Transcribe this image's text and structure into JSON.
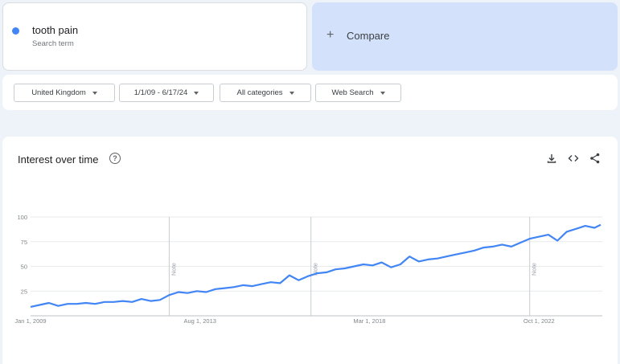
{
  "search_term": {
    "label": "tooth pain",
    "sublabel": "Search term",
    "color": "#4285f4"
  },
  "compare": {
    "icon": "plus-icon",
    "label": "Compare"
  },
  "filters": [
    {
      "label": "United Kingdom"
    },
    {
      "label": "1/1/09 - 6/17/24"
    },
    {
      "label": "All categories"
    },
    {
      "label": "Web Search"
    }
  ],
  "chart_section": {
    "title": "Interest over time",
    "help_icon": "help-circle-icon",
    "actions": [
      "download-icon",
      "embed-code-icon",
      "share-icon"
    ]
  },
  "chart_data": {
    "type": "line",
    "y_ticks": [
      "100",
      "75",
      "50",
      "25"
    ],
    "ylim": [
      0,
      100
    ],
    "x_ticks": [
      "Jan 1, 2009",
      "Aug 1, 2013",
      "Mar 1, 2018",
      "Oct 1, 2022"
    ],
    "notes": [
      "Note",
      "Note",
      "Note"
    ],
    "series": [
      {
        "color": "#4285f4",
        "points": [
          [
            "2009-01",
            9
          ],
          [
            "2009-04",
            11
          ],
          [
            "2009-07",
            13
          ],
          [
            "2009-10",
            10
          ],
          [
            "2010-01",
            12
          ],
          [
            "2010-04",
            12
          ],
          [
            "2010-07",
            13
          ],
          [
            "2010-10",
            12
          ],
          [
            "2011-01",
            14
          ],
          [
            "2011-04",
            14
          ],
          [
            "2011-07",
            15
          ],
          [
            "2011-10",
            14
          ],
          [
            "2012-01",
            17
          ],
          [
            "2012-04",
            15
          ],
          [
            "2012-07",
            16
          ],
          [
            "2012-10",
            21
          ],
          [
            "2013-01",
            24
          ],
          [
            "2013-04",
            23
          ],
          [
            "2013-07",
            25
          ],
          [
            "2013-10",
            24
          ],
          [
            "2014-01",
            27
          ],
          [
            "2014-04",
            28
          ],
          [
            "2014-07",
            29
          ],
          [
            "2014-10",
            31
          ],
          [
            "2015-01",
            30
          ],
          [
            "2015-04",
            32
          ],
          [
            "2015-07",
            34
          ],
          [
            "2015-10",
            33
          ],
          [
            "2016-01",
            41
          ],
          [
            "2016-04",
            36
          ],
          [
            "2016-07",
            40
          ],
          [
            "2016-10",
            43
          ],
          [
            "2017-01",
            44
          ],
          [
            "2017-04",
            47
          ],
          [
            "2017-07",
            48
          ],
          [
            "2017-10",
            50
          ],
          [
            "2018-01",
            52
          ],
          [
            "2018-04",
            51
          ],
          [
            "2018-07",
            54
          ],
          [
            "2018-10",
            49
          ],
          [
            "2019-01",
            52
          ],
          [
            "2019-04",
            60
          ],
          [
            "2019-07",
            55
          ],
          [
            "2019-10",
            57
          ],
          [
            "2020-01",
            58
          ],
          [
            "2020-04",
            60
          ],
          [
            "2020-07",
            62
          ],
          [
            "2020-10",
            64
          ],
          [
            "2021-01",
            66
          ],
          [
            "2021-04",
            69
          ],
          [
            "2021-07",
            70
          ],
          [
            "2021-10",
            72
          ],
          [
            "2022-01",
            70
          ],
          [
            "2022-04",
            74
          ],
          [
            "2022-07",
            78
          ],
          [
            "2022-10",
            80
          ],
          [
            "2023-01",
            82
          ],
          [
            "2023-04",
            76
          ],
          [
            "2023-07",
            85
          ],
          [
            "2023-10",
            88
          ],
          [
            "2024-01",
            91
          ],
          [
            "2024-04",
            89
          ],
          [
            "2024-06",
            92
          ]
        ]
      }
    ]
  }
}
